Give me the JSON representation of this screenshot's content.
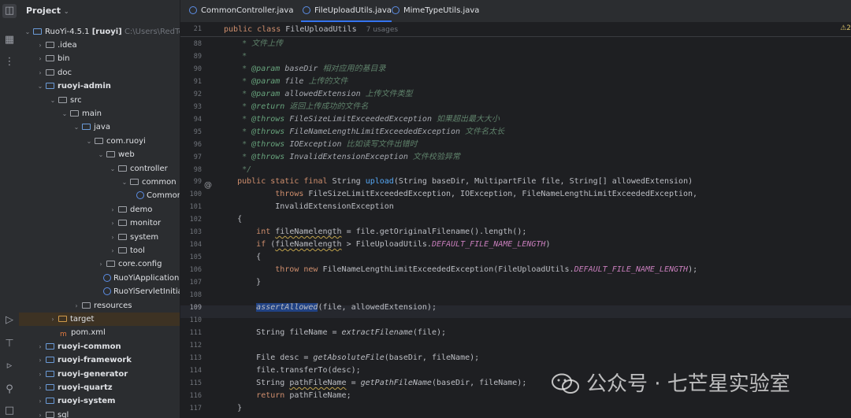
{
  "project": {
    "title": "Project",
    "root_name": "RuoYi-4.5.1",
    "root_module": "[ruoyi]",
    "root_path": "C:\\Users\\RedTeam",
    "items": [
      {
        "label": ".idea"
      },
      {
        "label": "bin"
      },
      {
        "label": "doc"
      },
      {
        "label": "ruoyi-admin"
      },
      {
        "label": "src"
      },
      {
        "label": "main"
      },
      {
        "label": "java"
      },
      {
        "label": "com.ruoyi"
      },
      {
        "label": "web"
      },
      {
        "label": "controller"
      },
      {
        "label": "common"
      },
      {
        "label": "CommonC"
      },
      {
        "label": "demo"
      },
      {
        "label": "monitor"
      },
      {
        "label": "system"
      },
      {
        "label": "tool"
      },
      {
        "label": "core.config"
      },
      {
        "label": "RuoYiApplication"
      },
      {
        "label": "RuoYiServletInitializ"
      },
      {
        "label": "resources"
      },
      {
        "label": "target"
      },
      {
        "label": "pom.xml"
      },
      {
        "label": "ruoyi-common"
      },
      {
        "label": "ruoyi-framework"
      },
      {
        "label": "ruoyi-generator"
      },
      {
        "label": "ruoyi-quartz"
      },
      {
        "label": "ruoyi-system"
      },
      {
        "label": "sql"
      }
    ]
  },
  "tabs": [
    {
      "label": "CommonController.java"
    },
    {
      "label": "FileUploadUtils.java"
    },
    {
      "label": "MimeTypeUtils.java"
    }
  ],
  "editor": {
    "warning_count": "2",
    "sticky": {
      "line": "21",
      "code": "public class FileUploadUtils",
      "usages": "7 usages"
    },
    "lines": [
      {
        "n": "88",
        "t": "     * 文件上传"
      },
      {
        "n": "89",
        "t": "     *"
      },
      {
        "n": "90",
        "tag": "@param",
        "var": "baseDir",
        "desc": "相对应用的基目录"
      },
      {
        "n": "91",
        "tag": "@param",
        "var": "file",
        "desc": "上传的文件"
      },
      {
        "n": "92",
        "tag": "@param",
        "var": "allowedExtension",
        "desc": "上传文件类型"
      },
      {
        "n": "93",
        "tag": "@return",
        "var": "",
        "desc": "返回上传成功的文件名"
      },
      {
        "n": "94",
        "tag": "@throws",
        "var": "FileSizeLimitExceededException",
        "desc": "如果超出最大大小"
      },
      {
        "n": "95",
        "tag": "@throws",
        "var": "FileNameLengthLimitExceededException",
        "desc": "文件名太长"
      },
      {
        "n": "96",
        "tag": "@throws",
        "var": "IOException",
        "desc": "比如读写文件出错时"
      },
      {
        "n": "97",
        "tag": "@throws",
        "var": "InvalidExtensionException",
        "desc": "文件校验异常"
      },
      {
        "n": "98",
        "t": "     */"
      },
      {
        "n": "99",
        "t": "    public static final String upload(String baseDir, MultipartFile file, String[] allowedExtension)"
      },
      {
        "n": "100",
        "t": "            throws FileSizeLimitExceededException, IOException, FileNameLengthLimitExceededException,"
      },
      {
        "n": "101",
        "t": "            InvalidExtensionException"
      },
      {
        "n": "102",
        "t": "    {"
      },
      {
        "n": "103",
        "t": "        int fileNamelength = file.getOriginalFilename().length();"
      },
      {
        "n": "104",
        "t": "        if (fileNamelength > FileUploadUtils.DEFAULT_FILE_NAME_LENGTH)"
      },
      {
        "n": "105",
        "t": "        {"
      },
      {
        "n": "106",
        "t": "            throw new FileNameLengthLimitExceededException(FileUploadUtils.DEFAULT_FILE_NAME_LENGTH);"
      },
      {
        "n": "107",
        "t": "        }"
      },
      {
        "n": "108",
        "t": ""
      },
      {
        "n": "109",
        "t": "        assertAllowed(file, allowedExtension);"
      },
      {
        "n": "110",
        "t": ""
      },
      {
        "n": "111",
        "t": "        String fileName = extractFilename(file);"
      },
      {
        "n": "112",
        "t": ""
      },
      {
        "n": "113",
        "t": "        File desc = getAbsoluteFile(baseDir, fileName);"
      },
      {
        "n": "114",
        "t": "        file.transferTo(desc);"
      },
      {
        "n": "115",
        "t": "        String pathFileName = getPathFileName(baseDir, fileName);"
      },
      {
        "n": "116",
        "t": "        return pathFileName;"
      },
      {
        "n": "117",
        "t": "    }"
      }
    ]
  },
  "watermark": {
    "text": "公众号 · 七芒星实验室"
  },
  "icons": [
    "folder-icon",
    "structure-icon",
    "more-icon",
    "run-icon",
    "build-icon",
    "debug-icon",
    "search-icon",
    "terminal-icon",
    "wechat-icon",
    "annotation-icon",
    "warning-icon"
  ]
}
